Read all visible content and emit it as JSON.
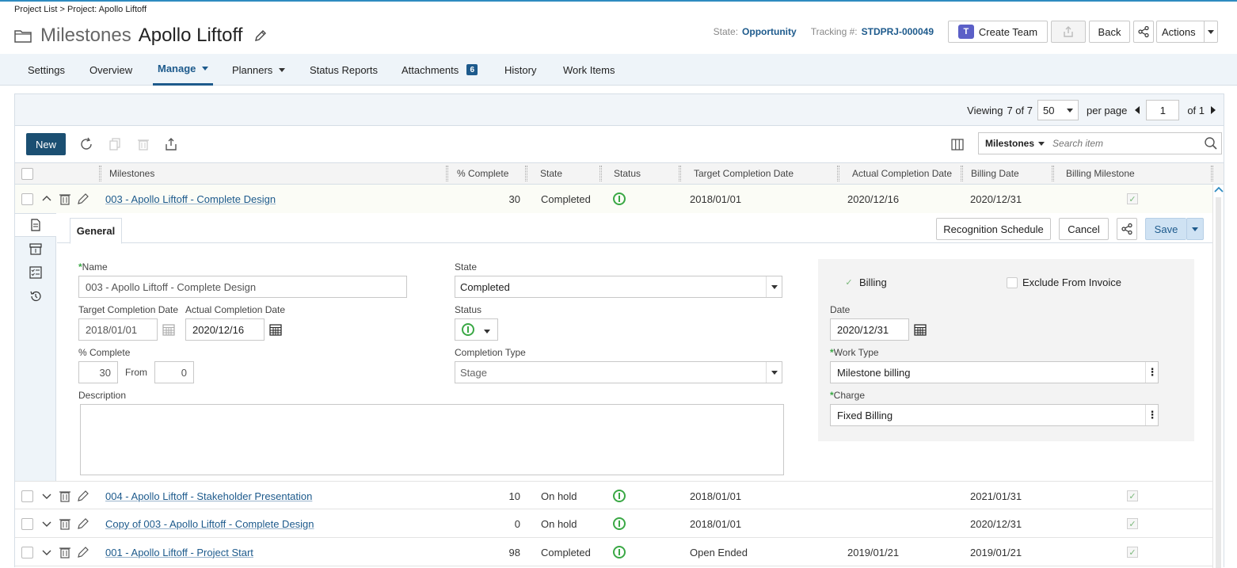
{
  "breadcrumb": "Project List > Project: Apollo Liftoff",
  "title": {
    "prefix": "Milestones",
    "name": "Apollo Liftoff"
  },
  "header": {
    "state_label": "State:",
    "state_value": "Opportunity",
    "tracking_label": "Tracking #:",
    "tracking_value": "STDPRJ-000049",
    "create_team": "Create Team",
    "back": "Back",
    "actions": "Actions",
    "teams_logo_letter": "T"
  },
  "nav": {
    "tabs": [
      "Settings",
      "Overview",
      "Manage",
      "Planners",
      "Status Reports",
      "Attachments",
      "History",
      "Work Items"
    ],
    "attachments_count": "6"
  },
  "pager": {
    "viewing_label": "Viewing",
    "viewing_count": "7 of 7",
    "per_page_value": "50",
    "per_page_label": "per page",
    "page": "1",
    "of_label": "of 1"
  },
  "toolbar": {
    "new": "New",
    "search_scope": "Milestones",
    "search_placeholder": "Search item"
  },
  "columns": [
    "Milestones",
    "% Complete",
    "State",
    "Status",
    "Target Completion Date",
    "Actual Completion Date",
    "Billing Date",
    "Billing Milestone"
  ],
  "rows": [
    {
      "name": "003 - Apollo Liftoff - Complete Design",
      "pct": "30",
      "state": "Completed",
      "target": "2018/01/01",
      "actual": "2020/12/16",
      "billing": "2020/12/31"
    },
    {
      "name": "004 - Apollo Liftoff - Stakeholder Presentation",
      "pct": "10",
      "state": "On hold",
      "target": "2018/01/01",
      "actual": "",
      "billing": "2021/01/31"
    },
    {
      "name": "Copy of 003 - Apollo Liftoff - Complete Design",
      "pct": "0",
      "state": "On hold",
      "target": "2018/01/01",
      "actual": "",
      "billing": "2020/12/31"
    },
    {
      "name": "001 - Apollo Liftoff - Project Start",
      "pct": "98",
      "state": "Completed",
      "target": "Open Ended",
      "actual": "2019/01/21",
      "billing": "2019/01/21"
    }
  ],
  "detail": {
    "tab": "General",
    "recognition": "Recognition Schedule",
    "cancel": "Cancel",
    "save": "Save",
    "name_label": "Name",
    "name_value": "003 - Apollo Liftoff - Complete Design",
    "target_label": "Target Completion Date",
    "target_value": "2018/01/01",
    "actual_label": "Actual Completion Date",
    "actual_value": "2020/12/16",
    "pct_label": "% Complete",
    "pct_value": "30",
    "from_label": "From",
    "from_value": "0",
    "desc_label": "Description",
    "state_label": "State",
    "state_value": "Completed",
    "status_label": "Status",
    "ctype_label": "Completion Type",
    "ctype_value": "Stage",
    "billing_label": "Billing",
    "exclude_label": "Exclude From Invoice",
    "date_label": "Date",
    "date_value": "2020/12/31",
    "worktype_label": "Work Type",
    "worktype_value": "Milestone billing",
    "charge_label": "Charge",
    "charge_value": "Fixed Billing",
    "req_mark": "*",
    "check_glyph": "✓"
  }
}
